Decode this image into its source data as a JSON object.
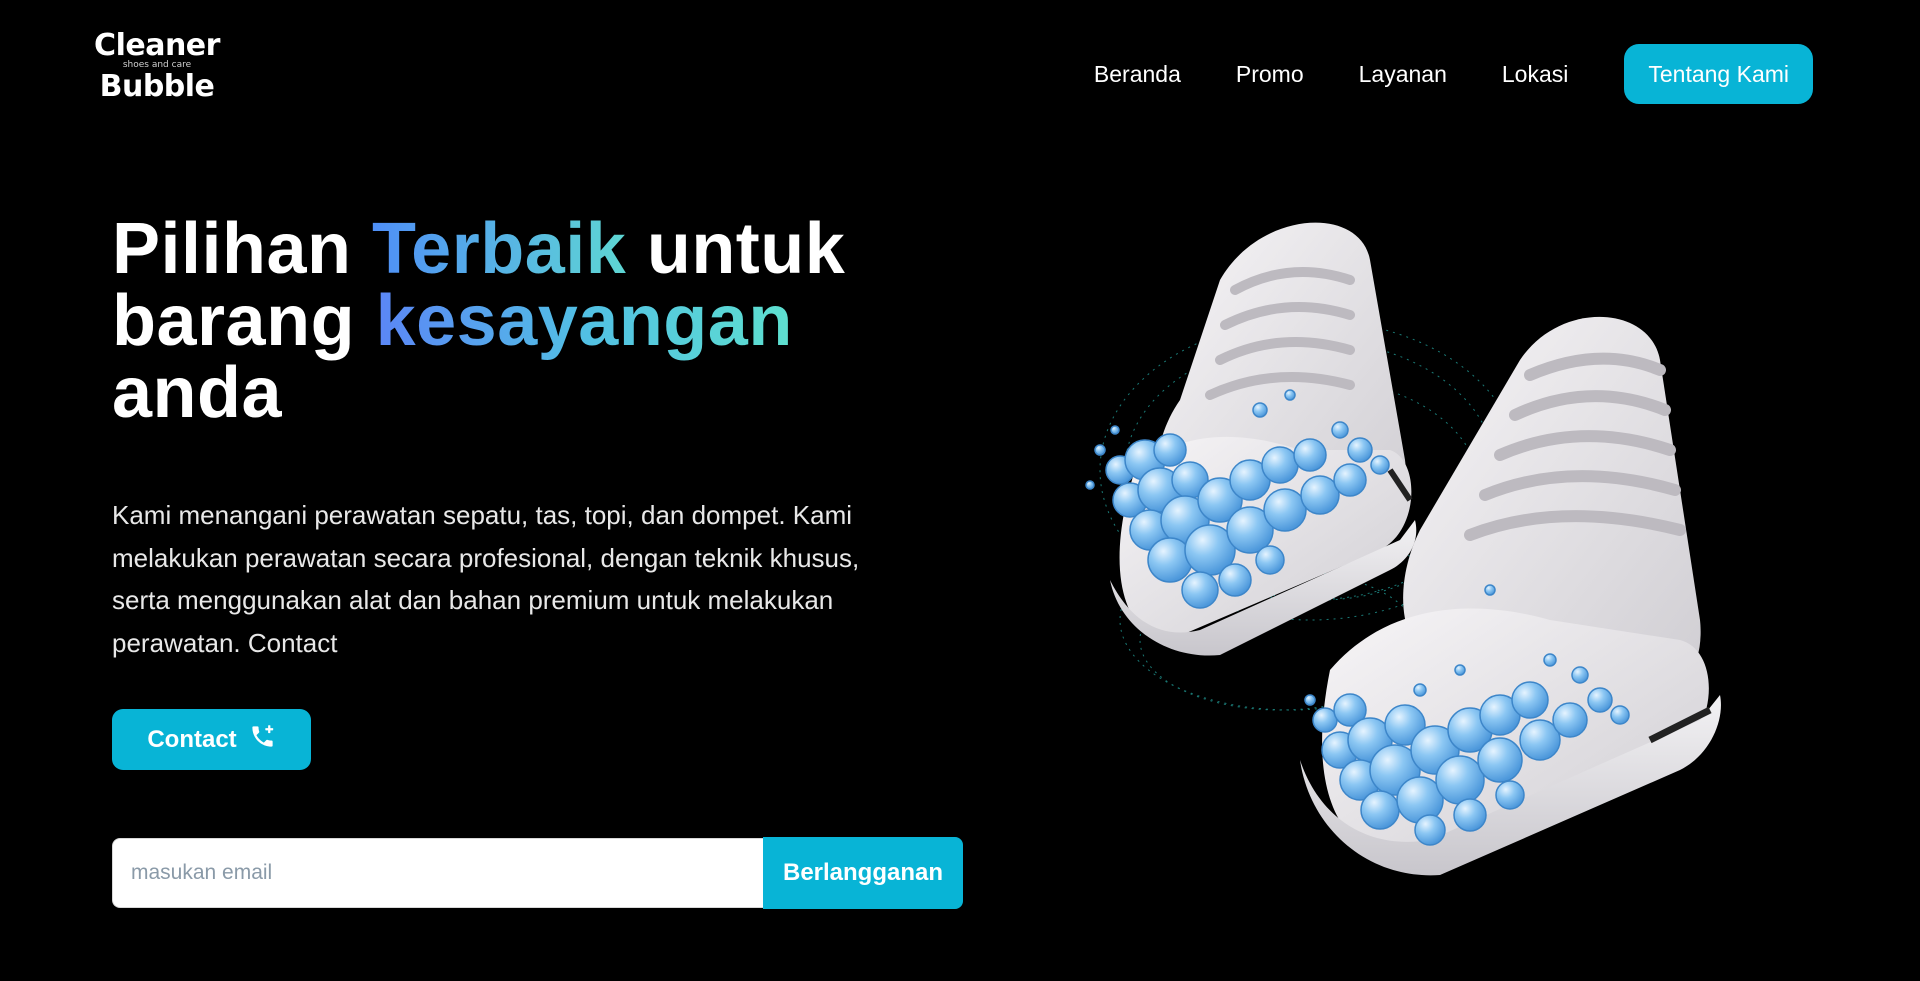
{
  "brand": {
    "line1": "Cleaner",
    "tagline": "shoes and care",
    "line2": "Bubble"
  },
  "nav": {
    "items": [
      "Beranda",
      "Promo",
      "Layanan",
      "Lokasi"
    ],
    "cta": "Tentang Kami"
  },
  "hero": {
    "title": {
      "part1": "Pilihan ",
      "highlight1": "Terbaik",
      "part2": " untuk barang ",
      "highlight2": "kesayangan",
      "part3": " anda"
    },
    "description": "Kami menangani perawatan sepatu, tas, topi, dan dompet. Kami melakukan perawatan secara profesional, dengan teknik khusus, serta menggunakan alat dan bahan premium untuk melakukan perawatan. Contact",
    "contact_button": "Contact",
    "contact_icon": "phone-icon"
  },
  "subscribe": {
    "placeholder": "masukan email",
    "value": "",
    "button": "Berlangganan"
  },
  "illustration": {
    "icon": "sneakers-with-bubbles-illustration"
  },
  "colors": {
    "accent": "#08b4d6",
    "background": "#000000",
    "gradient_start": "#4f8ff7",
    "gradient_end": "#5ed6d3"
  }
}
